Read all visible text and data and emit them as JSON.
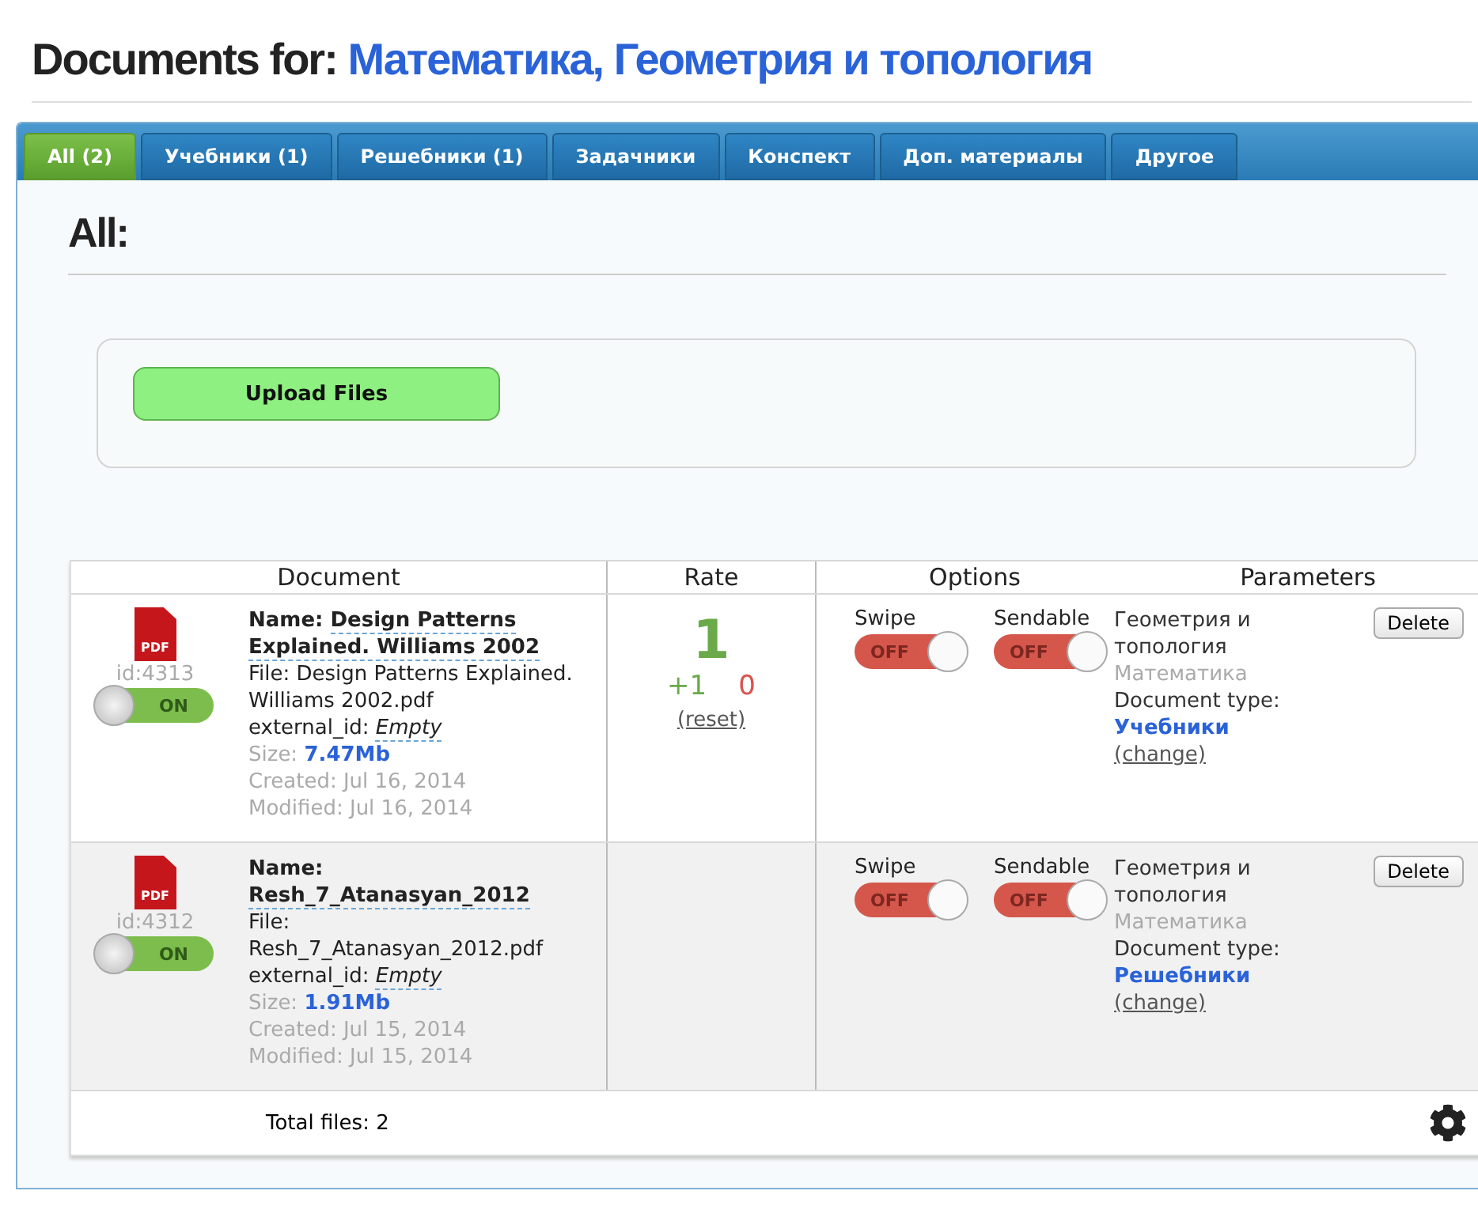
{
  "title": {
    "prefix": "Documents for:",
    "subject": "Математика, Геометрия и топология"
  },
  "tabs": [
    {
      "label": "All (2)",
      "selected": true
    },
    {
      "label": "Учебники (1)",
      "selected": false
    },
    {
      "label": "Решебники (1)",
      "selected": false
    },
    {
      "label": "Задачники",
      "selected": false
    },
    {
      "label": "Конспект",
      "selected": false
    },
    {
      "label": "Доп. материалы",
      "selected": false
    },
    {
      "label": "Другое",
      "selected": false
    }
  ],
  "section_heading": "All:",
  "upload_button": "Upload Files",
  "table": {
    "columns": [
      "Document",
      "Rate",
      "Options",
      "Parameters"
    ],
    "rows": [
      {
        "file_type": "PDF",
        "id": "id:4313",
        "enabled": true,
        "enabled_text": "ON",
        "name_label": "Name:",
        "name": "Design Patterns Explained. Williams 2002",
        "file": "File: Design Patterns Explained. Williams 2002.pdf",
        "external_id_label": "external_id:",
        "external_id": "Empty",
        "size_label": "Size:",
        "size": "7.47Mb",
        "created": "Created: Jul 16, 2014",
        "modified": "Modified: Jul 16, 2014",
        "rate": {
          "total": "1",
          "up": "+1",
          "down": "0",
          "reset": "(reset)"
        },
        "options": [
          {
            "label": "Swipe",
            "on": false,
            "state_text": "OFF"
          },
          {
            "label": "Sendable",
            "on": false,
            "state_text": "OFF"
          }
        ],
        "category": "Геометрия и топология",
        "subject": "Математика",
        "doc_type_label": "Document type:",
        "doc_type": "Учебники",
        "change": "(change)",
        "delete": "Delete"
      },
      {
        "file_type": "PDF",
        "id": "id:4312",
        "enabled": true,
        "enabled_text": "ON",
        "name_label": "Name:",
        "name": "Resh_7_Atanasyan_2012",
        "file": "File: Resh_7_Atanasyan_2012.pdf",
        "external_id_label": "external_id:",
        "external_id": "Empty",
        "size_label": "Size:",
        "size": "1.91Mb",
        "created": "Created: Jul 15, 2014",
        "modified": "Modified: Jul 15, 2014",
        "options": [
          {
            "label": "Swipe",
            "on": false,
            "state_text": "OFF"
          },
          {
            "label": "Sendable",
            "on": false,
            "state_text": "OFF"
          }
        ],
        "category": "Геометрия и топология",
        "subject": "Математика",
        "doc_type_label": "Document type:",
        "doc_type": "Решебники",
        "change": "(change)",
        "delete": "Delete"
      }
    ],
    "total": "Total files: 2"
  }
}
